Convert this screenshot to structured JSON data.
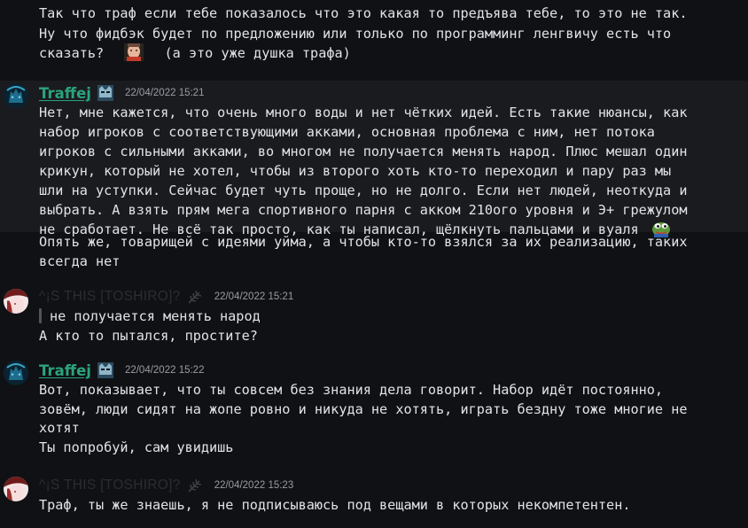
{
  "messages": [
    {
      "lines": [
        "Так что траф если тебе показалось что это какая то предъява тебе, то это не так.",
        "Ну что фидбэк будет по предложению или только по программинг ленгвичу есть что",
        "сказать?",
        "(а это уже душка трафа)"
      ]
    },
    {
      "author": "Traffej",
      "timestamp": "22/04/2022 15:21",
      "lines": [
        "Нет, мне кажется, что очень много воды и нет чётких идей. Есть такие нюансы, как",
        "набор игроков с соответствующими акками, основная проблема с ним, нет потока",
        "игроков с сильными акками, во многом не получается менять народ. Плюс мешал один",
        "крикун, который не хотел, чтобы из второго хоть кто-то переходил и пару раз мы",
        "шли на уступки. Сейчас будет чуть проще, но не долго. Если нет людей, неоткуда и",
        "выбрать. А взять прям мега спортивного парня с акком 210ого уровня и Э+ грежулом",
        "не сработает. Не всё так просто, как ты написал, щёлкнуть пальцами и вуаля"
      ],
      "followup": [
        "Опять же, товарищей с идеями уйма, а чтобы кто-то взялся за их реализацию, таких",
        "всегда нет"
      ]
    },
    {
      "author": "^¡S THIS [TOSHIRO]?",
      "timestamp": "22/04/2022 15:21",
      "quote": "не получается менять народ",
      "lines": [
        "А кто то пытался, простите?"
      ]
    },
    {
      "author": "Traffej",
      "timestamp": "22/04/2022 15:22",
      "lines": [
        "Вот, показывает, что ты совсем без знания дела говорит. Набор идёт постоянно,",
        "зовём, люди сидят на жопе ровно и никуда не хотять, играть бездну тоже многие не",
        "хотят"
      ],
      "followup": [
        "Ты попробуй, сам увидишь"
      ]
    },
    {
      "author": "^¡S THIS [TOSHIRO]?",
      "timestamp": "22/04/2022 15:23",
      "lines": [
        "Траф, ты же знаешь, я не подписываюсь под вещами в которых некомпетентен."
      ]
    }
  ],
  "icons": {
    "traffej_avatar": "traffej-avatar",
    "toshiro_avatar": "toshiro-avatar",
    "traffej_badge": "wolf-mask-badge",
    "toshiro_badge": "feather-badge",
    "emoji_face": "face-emoji",
    "emoji_pepe": "pepe-emoji"
  },
  "colors": {
    "background": "#101114",
    "highlight": "#1a1b1f",
    "traffej_name": "#2ba37c",
    "toshiro_name": "#2c2d30",
    "timestamp": "#9a9ca3",
    "text": "#e2e3e6"
  }
}
